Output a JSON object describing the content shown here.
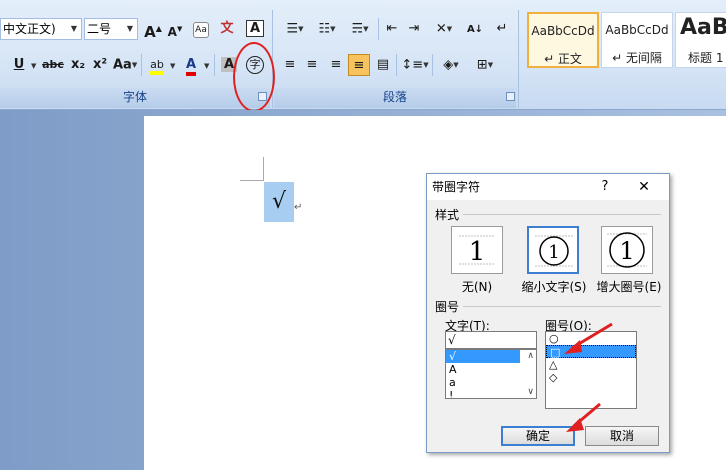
{
  "ribbon": {
    "font_name": "中文正文)",
    "font_size": "二号",
    "grow_font": "A",
    "shrink_font": "A",
    "phonetic": "文",
    "char_border": "A",
    "underline": "U",
    "strikethrough": "abc",
    "subscript": "x₂",
    "superscript": "x²",
    "change_case": "Aa",
    "highlight": "ab",
    "font_color": "A",
    "char_shading": "A",
    "enclose_char": "字",
    "font_group_label": "字体",
    "paragraph_group_label": "段落",
    "styles": [
      {
        "sample": "AaBbCcDd",
        "name": "↵ 正文"
      },
      {
        "sample": "AaBbCcDd",
        "name": "↵ 无间隔"
      },
      {
        "sample": "AaB",
        "name": "标题 1"
      }
    ]
  },
  "document": {
    "selected_char": "√",
    "paragraph_mark": "↵"
  },
  "dialog": {
    "title": "带圈字符",
    "help": "?",
    "close": "✕",
    "style_section": "样式",
    "options": [
      {
        "glyph": "1",
        "label": "无(N)"
      },
      {
        "glyph": "①",
        "label": "缩小文字(S)"
      },
      {
        "glyph": "①",
        "label": "增大圈号(E)"
      }
    ],
    "enclosure_section": "圈号",
    "text_label": "文字(T):",
    "circle_label": "圈号(O):",
    "text_value": "√",
    "text_list": [
      "√",
      "A",
      "a",
      "!"
    ],
    "circle_list": [
      "○",
      "□",
      "△",
      "◇"
    ],
    "ok": "确定",
    "cancel": "取消"
  },
  "colors": {
    "annotation_red": "#e02020",
    "selection_blue": "#3399ff",
    "ribbon_text": "#15428b"
  }
}
